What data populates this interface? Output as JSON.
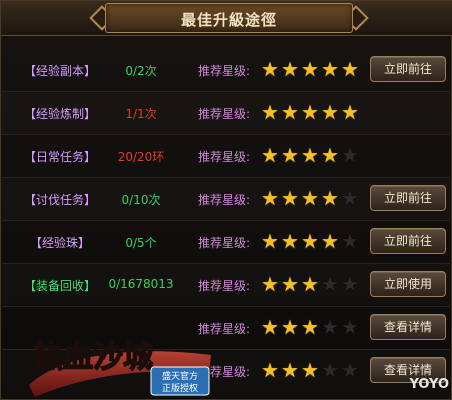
{
  "header": {
    "title": "最佳升級途徑"
  },
  "rec_label": "推荐星级:",
  "rows": [
    {
      "name": "【经验副本】",
      "progress": "0/2次",
      "stars": 5,
      "button": "立即前往"
    },
    {
      "name": "【经验炼制】",
      "progress": "1/1次",
      "stars": 5,
      "button": ""
    },
    {
      "name": "【日常任务】",
      "progress": "20/20环",
      "stars": 4,
      "button": ""
    },
    {
      "name": "【讨伐任务】",
      "progress": "0/10次",
      "stars": 4,
      "button": "立即前往"
    },
    {
      "name": "【经验珠】",
      "progress": "0/5个",
      "stars": 4,
      "button": "立即前往"
    },
    {
      "name": "【装备回收】",
      "progress": "0/1678013",
      "stars": 3,
      "button": "立即使用"
    },
    {
      "name": "",
      "progress": "",
      "stars": 3,
      "button": "查看详情"
    },
    {
      "name": "",
      "progress": "",
      "stars": 3,
      "button": "查看详情"
    }
  ],
  "logo": {
    "main": "热血沙城",
    "stamp": "盛天官方正版授权"
  },
  "watermark": "YOYO",
  "colors": {
    "star_on": "#f2c12a",
    "star_off": "#2e2a26",
    "progress_green": "#37d25a",
    "progress_red": "#e23a2e"
  }
}
